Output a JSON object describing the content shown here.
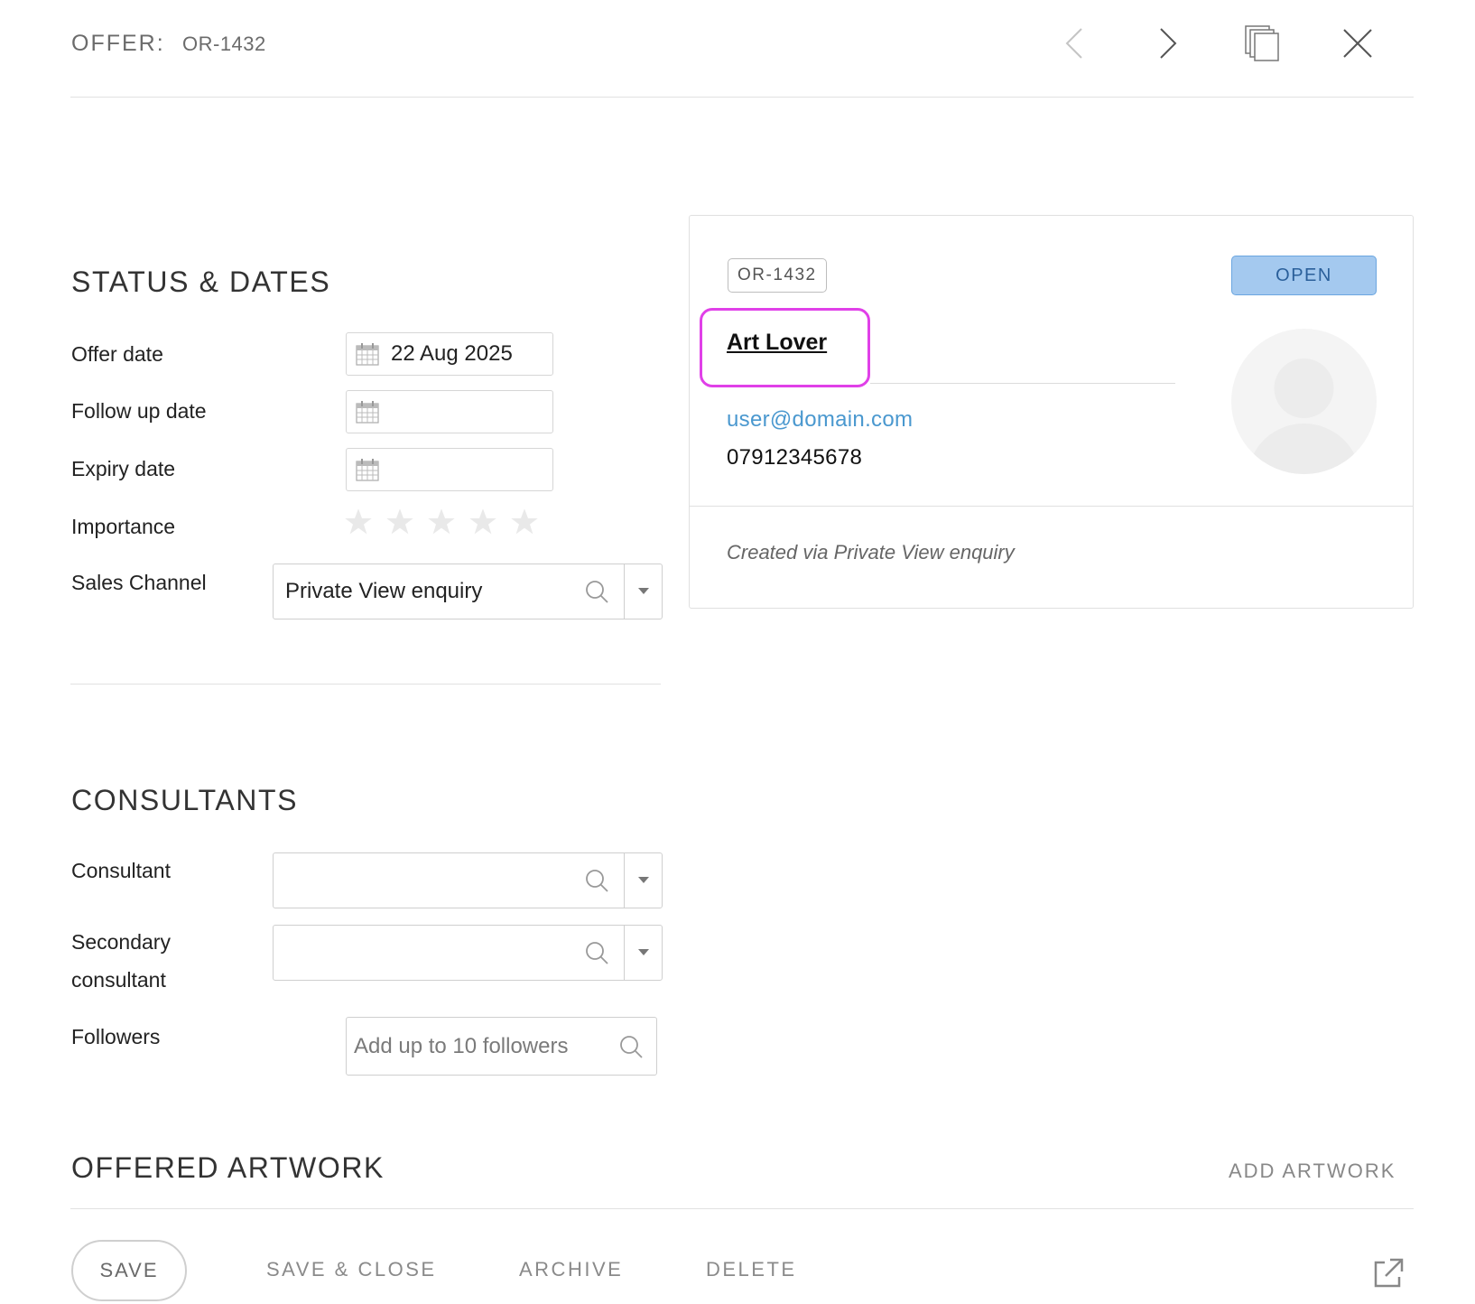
{
  "header": {
    "title": "OFFER:",
    "record_id": "OR-1432",
    "icons": [
      "chevron-left-icon",
      "chevron-right-icon",
      "copy-icon",
      "close-icon"
    ]
  },
  "status_dates": {
    "title": "STATUS & DATES",
    "offer_date_label": "Offer date",
    "offer_date_value": "22 Aug 2025",
    "follow_up_label": "Follow up date",
    "follow_up_value": "",
    "expiry_label": "Expiry date",
    "expiry_value": "",
    "importance_label": "Importance",
    "importance_value": 0,
    "importance_max": 5,
    "sales_channel_label": "Sales Channel",
    "sales_channel_value": "Private View enquiry"
  },
  "card": {
    "tag": "OR-1432",
    "status": "OPEN",
    "client_name": "Art Lover",
    "email": "user@domain.com",
    "phone": "07912345678",
    "note": "Created via Private View enquiry",
    "colors": {
      "status_bg": "#a4c9ef",
      "status_text": "#2a5f9a",
      "highlight": "#e040e8",
      "email": "#4a98cf"
    }
  },
  "consultants": {
    "title": "CONSULTANTS",
    "consultant_label": "Consultant",
    "consultant_value": "",
    "secondary_label_line1": "Secondary",
    "secondary_label_line2": "consultant",
    "secondary_value": "",
    "followers_label": "Followers",
    "followers_placeholder": "Add up to 10 followers"
  },
  "offered_artwork": {
    "title": "OFFERED ARTWORK",
    "add_label": "ADD ARTWORK"
  },
  "footer": {
    "save": "SAVE",
    "save_close": "SAVE & CLOSE",
    "archive": "ARCHIVE",
    "delete": "DELETE",
    "external_icon": "external-link-icon"
  }
}
